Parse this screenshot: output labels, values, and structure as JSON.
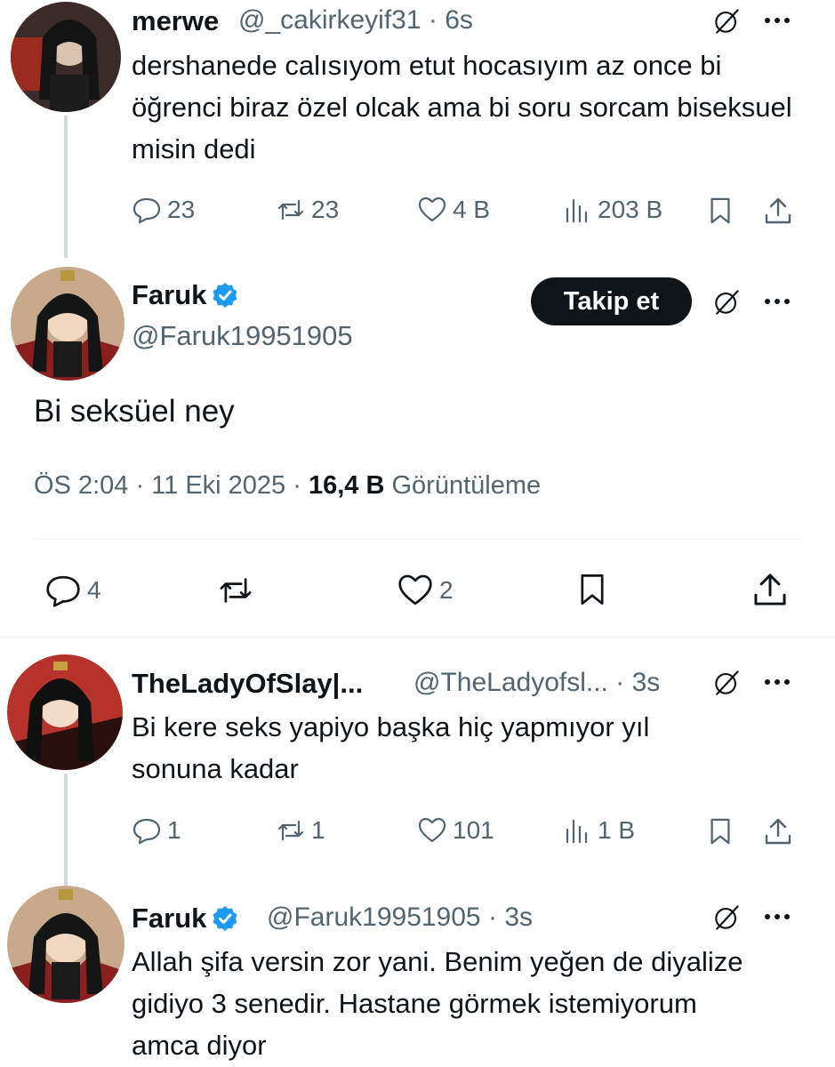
{
  "tweets": [
    {
      "name": "merwe",
      "handle": "@_cakirkeyif31",
      "time": "6s",
      "text": "dershanede calısıyom etut hocasıyım az once bi öğrenci biraz özel olcak ama bi soru sorcam biseksuel misin dedi",
      "replies": "23",
      "retweets": "23",
      "likes": "4 B",
      "views": "203 B"
    },
    {
      "name": "TheLadyOfSlay|...",
      "handle": "@TheLadyofsl...",
      "time": "3s",
      "text": "Bi kere seks yapiyo başka hiç yapmıyor yıl sonuna kadar",
      "replies": "1",
      "retweets": "1",
      "likes": "101",
      "views": "1 B"
    },
    {
      "name": "Faruk",
      "handle": "@Faruk19951905",
      "time": "3s",
      "text": "Allah şifa versin zor yani. Benim yeğen de diyalize gidiyo 3 senedir. Hastane görmek istemiyorum amca diyor"
    }
  ],
  "main_tweet": {
    "name": "Faruk",
    "handle": "@Faruk19951905",
    "follow_label": "Takip et",
    "text": "Bi seksüel ney",
    "timestamp": "ÖS 2:04 · 11 Eki 2025 ·",
    "views_count": "16,4 B",
    "views_label": "Görüntüleme",
    "replies": "4",
    "likes": "2"
  },
  "separator": "·",
  "colors": {
    "text": "#0f1419",
    "muted": "#536471",
    "verified": "#1d9bf0",
    "divider": "#eff3f4"
  }
}
